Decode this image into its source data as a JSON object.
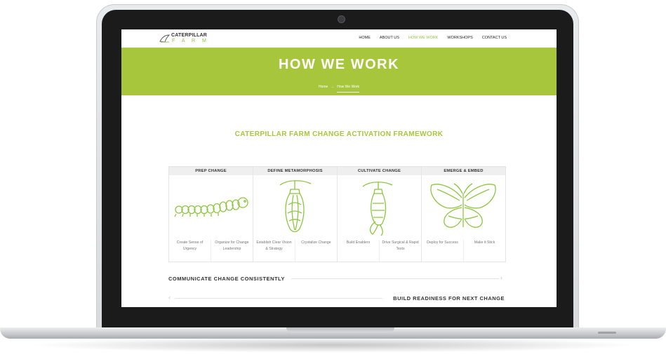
{
  "nav": {
    "logo": {
      "top": "CATERPILLAR",
      "bottom": "F A R M"
    },
    "menu": [
      {
        "label": "HOME",
        "active": false
      },
      {
        "label": "ABOUT US",
        "active": false
      },
      {
        "label": "HOW WE WORK",
        "active": true
      },
      {
        "label": "WORKSHOPS",
        "active": false
      },
      {
        "label": "CONTACT US",
        "active": false
      }
    ]
  },
  "hero": {
    "title": "HOW WE WORK",
    "breadcrumb": {
      "home": "Home",
      "separator": "→",
      "current": "How We Work"
    }
  },
  "section_title": "CATERPILLAR FARM CHANGE ACTIVATION FRAMEWORK",
  "framework": [
    {
      "heading": "PREP CHANGE",
      "art": "caterpillar-illustration",
      "items": [
        "Create Sense of Urgency",
        "Organize for Change Leadership"
      ]
    },
    {
      "heading": "DEFINE METAMORPHOSIS",
      "art": "cocoon-illustration",
      "items": [
        "Establish Clear Vision & Strategy",
        "Crystalize Change"
      ]
    },
    {
      "heading": "CULTIVATE CHANGE",
      "art": "emerging-butterfly-illustration",
      "items": [
        "Build Enablers",
        "Drive Surgical & Rapid Tests"
      ]
    },
    {
      "heading": "EMERGE & EMBED",
      "art": "butterfly-illustration",
      "items": [
        "Deploy for Success",
        "Make it Stick"
      ]
    }
  ],
  "rows": {
    "communicate": "COMMUNICATE CHANGE CONSISTENTLY",
    "build": "BUILD READINESS FOR NEXT CHANGE"
  },
  "colors": {
    "accent": "#a7c63c",
    "nav_active": "#8cc63f",
    "text": "#333333"
  }
}
